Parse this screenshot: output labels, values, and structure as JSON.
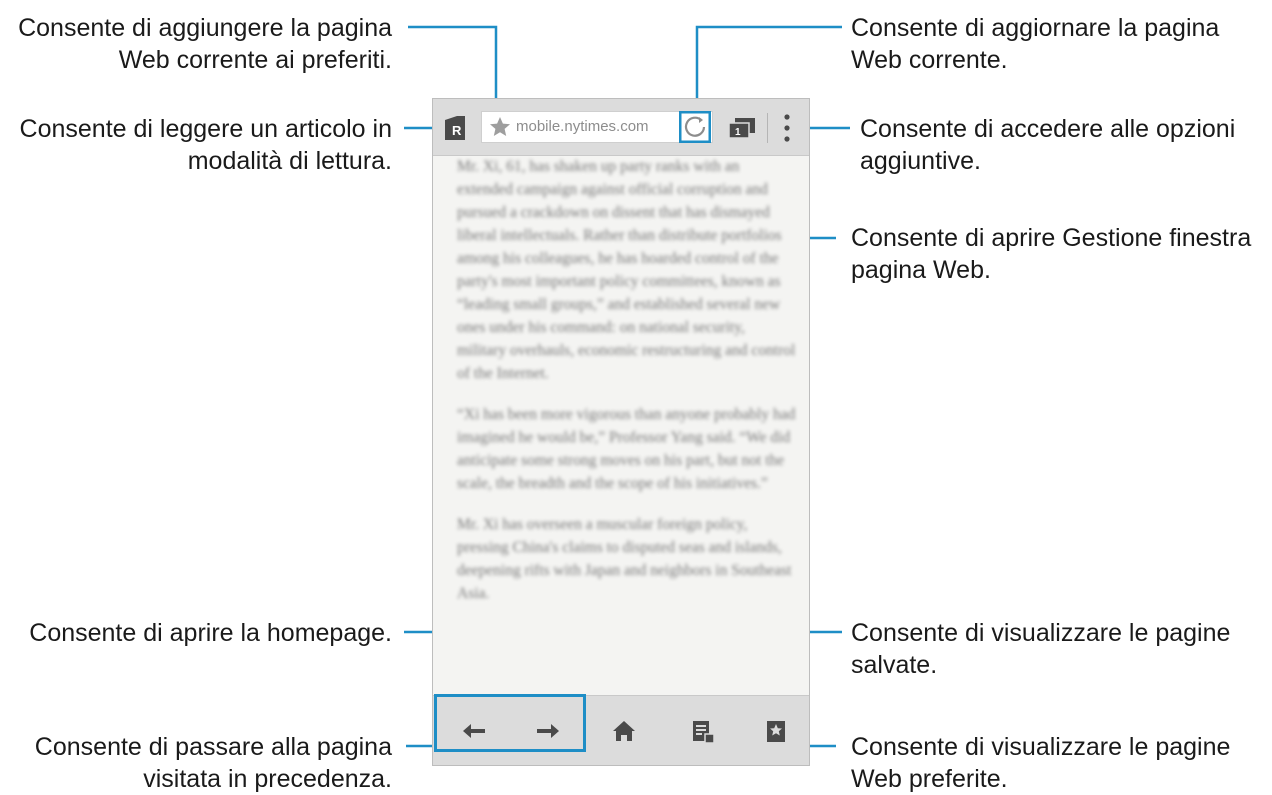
{
  "phone": {
    "url": "mobile.nytimes.com",
    "article_paragraphs": [
      "Mr. Xi, 61, has shaken up party ranks with an extended campaign against official corruption and pursued a crackdown on dissent that has dismayed liberal intellectuals. Rather than distribute portfolios among his colleagues, he has hoarded control of the party's most important policy committees, known as “leading small groups,” and established several new ones under his command: on national security, military overhauls, economic restructuring and control of the Internet.",
      "“Xi has been more vigorous than anyone probably had imagined he would be,” Professor Yang said. “We did anticipate some strong moves on his part, but not the scale, the breadth and the scope of his initiatives.”",
      "Mr. Xi has overseen a muscular foreign policy, pressing China's claims to disputed seas and islands, deepening rifts with Japan and neighbors in Southeast Asia."
    ]
  },
  "callouts": {
    "add_bookmark": [
      "Consente di aggiungere la pagina",
      "Web corrente ai preferiti."
    ],
    "reader_mode": [
      "Consente di leggere un articolo in",
      "modalità di lettura."
    ],
    "refresh": [
      "Consente di aggiornare la pagina",
      "Web corrente."
    ],
    "more_options": [
      "Consente di accedere alle opzioni",
      "aggiuntive."
    ],
    "window_manager": [
      "Consente di aprire Gestione finestra",
      "pagina Web."
    ],
    "homepage": [
      "Consente di aprire la homepage."
    ],
    "saved_pages": [
      "Consente di visualizzare le pagine",
      "salvate."
    ],
    "previous_page": [
      "Consente di passare alla pagina",
      "visitata in precedenza."
    ],
    "bookmarks": [
      "Consente di visualizzare le pagine",
      "Web preferite."
    ]
  },
  "colors": {
    "accent": "#1e8ec6",
    "toolbar": "#dcdcdc",
    "icon": "#4a4a4a"
  }
}
